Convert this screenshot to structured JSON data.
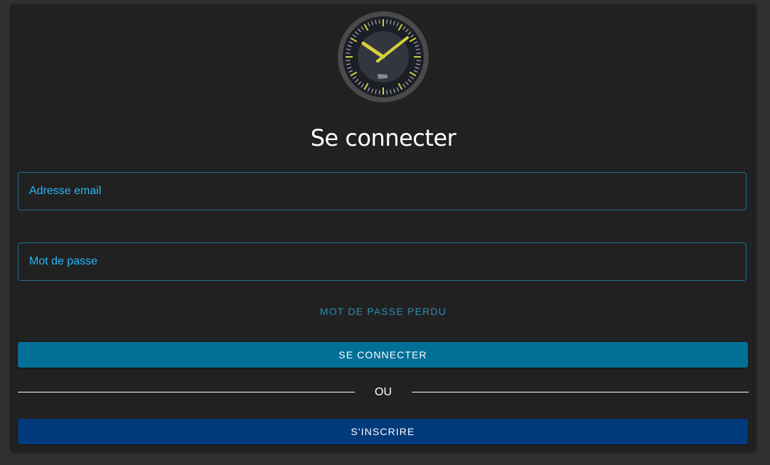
{
  "header": {
    "title": "Se connecter"
  },
  "form": {
    "email_placeholder": "Adresse email",
    "password_placeholder": "Mot de passe",
    "forgot_label": "MOT DE PASSE PERDU",
    "login_label": "SE CONNECTER",
    "divider_label": "OU",
    "register_label": "S'INSCRIRE"
  },
  "logo": {
    "icon": "clock-icon"
  },
  "colors": {
    "background": "#303030",
    "card": "#212121",
    "accent": "#29b6f6",
    "login_button": "#016f96",
    "register_button": "#003a7a",
    "clock_hands": "#d4d13a"
  }
}
